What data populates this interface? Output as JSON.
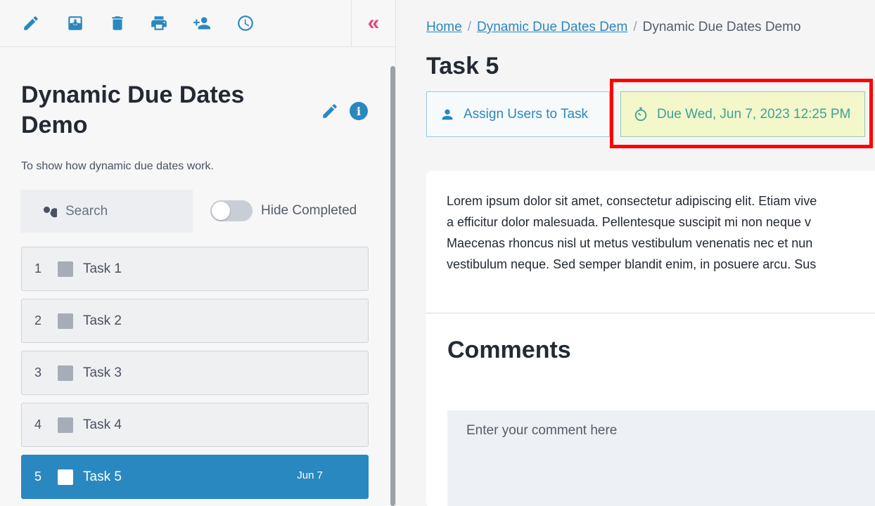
{
  "toolbar": {
    "icons": [
      "edit-icon",
      "archive-icon",
      "delete-icon",
      "print-icon",
      "add-user-icon",
      "clock-icon"
    ],
    "collapse_icon": "«"
  },
  "project": {
    "title": "Dynamic Due Dates Demo",
    "description": "To show how dynamic due dates work.",
    "info_icon": "i"
  },
  "search": {
    "placeholder": "Search"
  },
  "filter": {
    "hide_completed_label": "Hide Completed",
    "hide_completed_on": false
  },
  "tasks": [
    {
      "num": "1",
      "name": "Task 1",
      "due": ""
    },
    {
      "num": "2",
      "name": "Task 2",
      "due": ""
    },
    {
      "num": "3",
      "name": "Task 3",
      "due": ""
    },
    {
      "num": "4",
      "name": "Task 4",
      "due": ""
    },
    {
      "num": "5",
      "name": "Task 5",
      "due": "Jun 7"
    }
  ],
  "breadcrumb": {
    "home": "Home",
    "project": "Dynamic Due Dates Dem",
    "current": "Dynamic Due Dates Demo",
    "separator": "/"
  },
  "task_detail": {
    "title": "Task 5",
    "assign_label": "Assign Users to Task",
    "due_label": "Due Wed, Jun 7, 2023 12:25 PM",
    "body_lines": [
      "Lorem ipsum dolor sit amet, consectetur adipiscing elit. Etiam vive",
      "a efficitur dolor malesuada. Pellentesque suscipit mi non neque v",
      "Maecenas rhoncus nisl ut metus vestibulum venenatis nec et nun",
      "vestibulum neque. Sed semper blandit enim, in posuere arcu. Sus"
    ],
    "comments_heading": "Comments",
    "comment_placeholder": "Enter your comment here"
  },
  "colors": {
    "accent": "#2a88c0",
    "highlight": "#ff0000",
    "due_bg": "#f4f7c9",
    "collapse": "#e5457b"
  }
}
